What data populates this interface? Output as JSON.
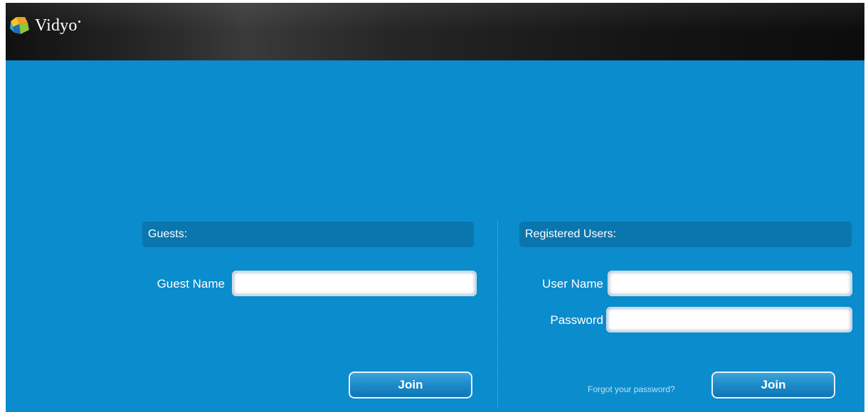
{
  "brand": {
    "name": "Vidyo",
    "logo_icon": "vidyo-logo-icon"
  },
  "guests": {
    "header": "Guests:",
    "name_label": "Guest Name",
    "name_value": "",
    "join_label": "Join"
  },
  "registered": {
    "header": "Registered Users:",
    "username_label": "User Name",
    "username_value": "",
    "password_label": "Password",
    "password_value": "",
    "forgot_label": "Forgot your password?",
    "join_label": "Join"
  },
  "colors": {
    "background": "#0a8ccd",
    "header_bar": "#0b76ad",
    "top_bar": "#1a1a1a"
  }
}
